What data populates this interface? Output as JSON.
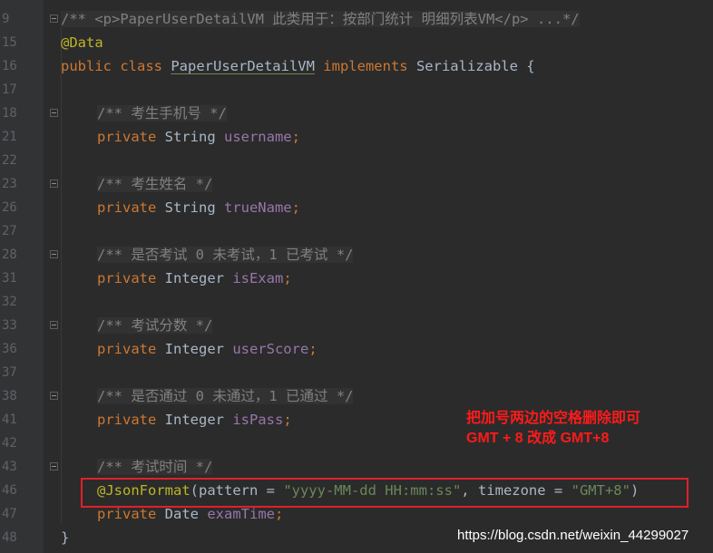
{
  "editor": {
    "lines": [
      {
        "num": "9",
        "fold": true,
        "indent": false,
        "parts": [
          {
            "t": "/** <p>PaperUserDetailVM 此类用于：按部门统计 明细列表VM</p> ...*/",
            "c": "cmt doc-hl"
          }
        ]
      },
      {
        "num": "15",
        "fold": false,
        "indent": false,
        "parts": [
          {
            "t": "@Data",
            "c": "ann"
          }
        ]
      },
      {
        "num": "16",
        "fold": false,
        "indent": false,
        "parts": [
          {
            "t": "public class ",
            "c": "kw"
          },
          {
            "t": "PaperUserDetailVM",
            "c": "typ cls-decl"
          },
          {
            "t": " implements ",
            "c": "kw"
          },
          {
            "t": "Serializable {",
            "c": "typ"
          }
        ]
      },
      {
        "num": "17",
        "fold": false,
        "indent": false,
        "parts": []
      },
      {
        "num": "18",
        "fold": true,
        "indent": true,
        "parts": [
          {
            "t": "/** 考生手机号 */",
            "c": "cmt doc-hl"
          }
        ]
      },
      {
        "num": "21",
        "fold": false,
        "indent": true,
        "parts": [
          {
            "t": "private ",
            "c": "kw"
          },
          {
            "t": "String ",
            "c": "typ"
          },
          {
            "t": "username",
            "c": "fld"
          },
          {
            "t": ";",
            "c": "kw"
          }
        ]
      },
      {
        "num": "22",
        "fold": false,
        "indent": false,
        "parts": []
      },
      {
        "num": "23",
        "fold": true,
        "indent": true,
        "parts": [
          {
            "t": "/** 考生姓名 */",
            "c": "cmt doc-hl"
          }
        ]
      },
      {
        "num": "26",
        "fold": false,
        "indent": true,
        "parts": [
          {
            "t": "private ",
            "c": "kw"
          },
          {
            "t": "String ",
            "c": "typ"
          },
          {
            "t": "trueName",
            "c": "fld"
          },
          {
            "t": ";",
            "c": "kw"
          }
        ]
      },
      {
        "num": "27",
        "fold": false,
        "indent": false,
        "parts": []
      },
      {
        "num": "28",
        "fold": true,
        "indent": true,
        "parts": [
          {
            "t": "/** 是否考试 0 未考试，1 已考试 */",
            "c": "cmt doc-hl"
          }
        ]
      },
      {
        "num": "31",
        "fold": false,
        "indent": true,
        "parts": [
          {
            "t": "private ",
            "c": "kw"
          },
          {
            "t": "Integer ",
            "c": "typ"
          },
          {
            "t": "isExam",
            "c": "fld"
          },
          {
            "t": ";",
            "c": "kw"
          }
        ]
      },
      {
        "num": "32",
        "fold": false,
        "indent": false,
        "parts": []
      },
      {
        "num": "33",
        "fold": true,
        "indent": true,
        "parts": [
          {
            "t": "/** 考试分数 */",
            "c": "cmt doc-hl"
          }
        ]
      },
      {
        "num": "36",
        "fold": false,
        "indent": true,
        "parts": [
          {
            "t": "private ",
            "c": "kw"
          },
          {
            "t": "Integer ",
            "c": "typ"
          },
          {
            "t": "userScore",
            "c": "fld"
          },
          {
            "t": ";",
            "c": "kw"
          }
        ]
      },
      {
        "num": "37",
        "fold": false,
        "indent": false,
        "parts": []
      },
      {
        "num": "38",
        "fold": true,
        "indent": true,
        "parts": [
          {
            "t": "/** 是否通过 0 未通过，1 已通过 */",
            "c": "cmt doc-hl"
          }
        ]
      },
      {
        "num": "41",
        "fold": false,
        "indent": true,
        "parts": [
          {
            "t": "private ",
            "c": "kw"
          },
          {
            "t": "Integer ",
            "c": "typ"
          },
          {
            "t": "isPass",
            "c": "fld"
          },
          {
            "t": ";",
            "c": "kw"
          }
        ]
      },
      {
        "num": "42",
        "fold": false,
        "indent": false,
        "parts": []
      },
      {
        "num": "43",
        "fold": true,
        "indent": true,
        "parts": [
          {
            "t": "/** 考试时间 */",
            "c": "cmt doc-hl"
          }
        ]
      },
      {
        "num": "46",
        "fold": false,
        "indent": true,
        "parts": [
          {
            "t": "@JsonFormat",
            "c": "ann"
          },
          {
            "t": "(pattern = ",
            "c": "typ"
          },
          {
            "t": "\"yyyy-MM-dd HH:mm:ss\"",
            "c": "str"
          },
          {
            "t": ", timezone = ",
            "c": "typ"
          },
          {
            "t": "\"GMT+8\"",
            "c": "str"
          },
          {
            "t": ")",
            "c": "typ"
          }
        ]
      },
      {
        "num": "47",
        "fold": false,
        "indent": true,
        "parts": [
          {
            "t": "private ",
            "c": "kw"
          },
          {
            "t": "Date ",
            "c": "typ"
          },
          {
            "t": "examTime",
            "c": "fld"
          },
          {
            "t": ";",
            "c": "kw"
          }
        ]
      },
      {
        "num": "48",
        "fold": false,
        "indent": false,
        "parts": [
          {
            "t": "}",
            "c": "typ"
          }
        ]
      }
    ]
  },
  "annotation": {
    "line1": "把加号两边的空格删除即可",
    "line2": "GMT + 8 改成  GMT+8"
  },
  "watermark": "https://blog.csdn.net/weixin_44299027",
  "colors": {
    "background": "#2b2b2b",
    "keyword": "#cc7832",
    "annotation": "#bbb529",
    "field": "#9876aa",
    "string": "#6a8759",
    "comment": "#808080",
    "highlight_box": "#e0202a",
    "note_text": "#ff1a1a"
  }
}
